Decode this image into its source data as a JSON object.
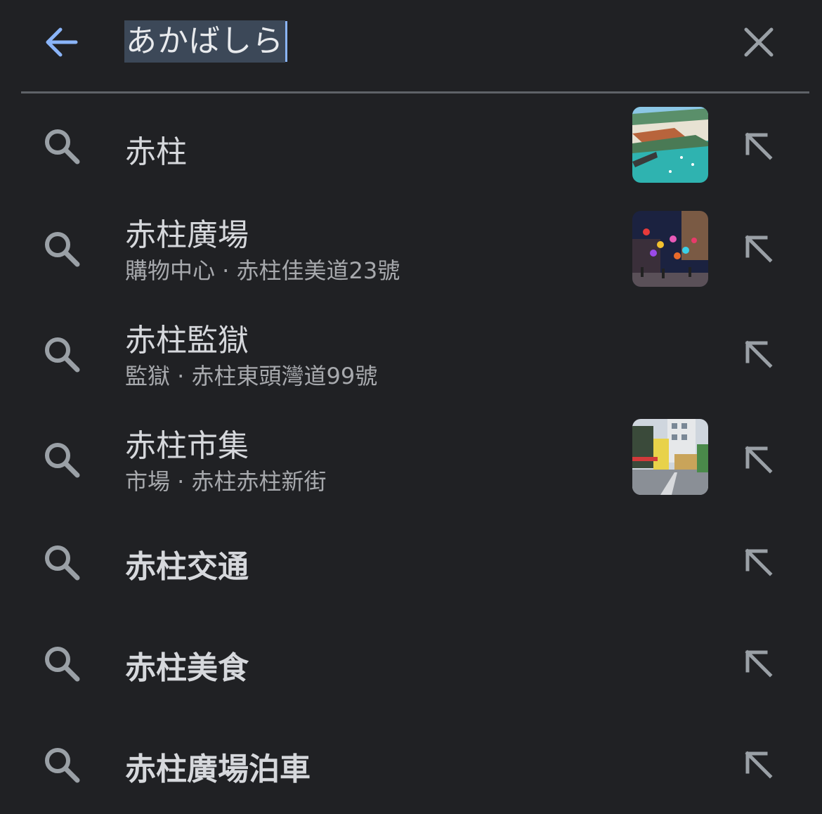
{
  "search": {
    "query": "あかばしら",
    "back_icon": "arrow-left-icon",
    "clear_icon": "close-icon"
  },
  "colors": {
    "background": "#202124",
    "accent": "#8ab4f8",
    "selection": "#3c4858",
    "title_text": "#d6d8dc",
    "subtitle_text": "#a7a9ad",
    "icon": "#9aa0a6"
  },
  "suggestions": [
    {
      "title": "赤柱",
      "subtitle": "",
      "bold": false,
      "thumbnail": "aerial-bay-photo"
    },
    {
      "title": "赤柱廣場",
      "subtitle": "購物中心 · 赤柱佳美道23號",
      "bold": false,
      "thumbnail": "plaza-lanterns-photo"
    },
    {
      "title": "赤柱監獄",
      "subtitle": "監獄 · 赤柱東頭灣道99號",
      "bold": false,
      "thumbnail": ""
    },
    {
      "title": "赤柱市集",
      "subtitle": "市場 · 赤柱赤柱新街",
      "bold": false,
      "thumbnail": "market-street-photo"
    },
    {
      "title": "赤柱交通",
      "subtitle": "",
      "bold": true,
      "thumbnail": ""
    },
    {
      "title": "赤柱美食",
      "subtitle": "",
      "bold": true,
      "thumbnail": ""
    },
    {
      "title": "赤柱廣場泊車",
      "subtitle": "",
      "bold": true,
      "thumbnail": ""
    }
  ]
}
